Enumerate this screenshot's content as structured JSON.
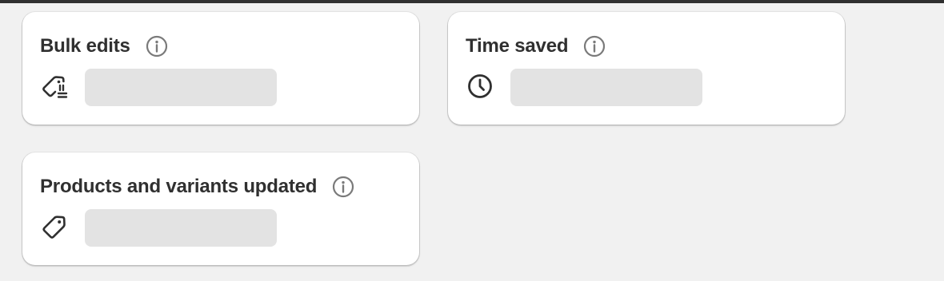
{
  "cards": {
    "bulk_edits": {
      "title": "Bulk edits",
      "info_icon": "info-circle-icon",
      "metric_icon": "tag-edit-icon",
      "value": ""
    },
    "time_saved": {
      "title": "Time saved",
      "info_icon": "info-circle-icon",
      "metric_icon": "clock-icon",
      "value": ""
    },
    "products_variants_updated": {
      "title": "Products and variants updated",
      "info_icon": "info-circle-icon",
      "metric_icon": "tag-icon",
      "value": ""
    }
  },
  "colors": {
    "page_background": "#f1f1f1",
    "card_background": "#ffffff",
    "text": "#303030",
    "icon_muted": "#7a7a7a",
    "skeleton": "#e3e3e3",
    "top_bar": "#303030"
  }
}
